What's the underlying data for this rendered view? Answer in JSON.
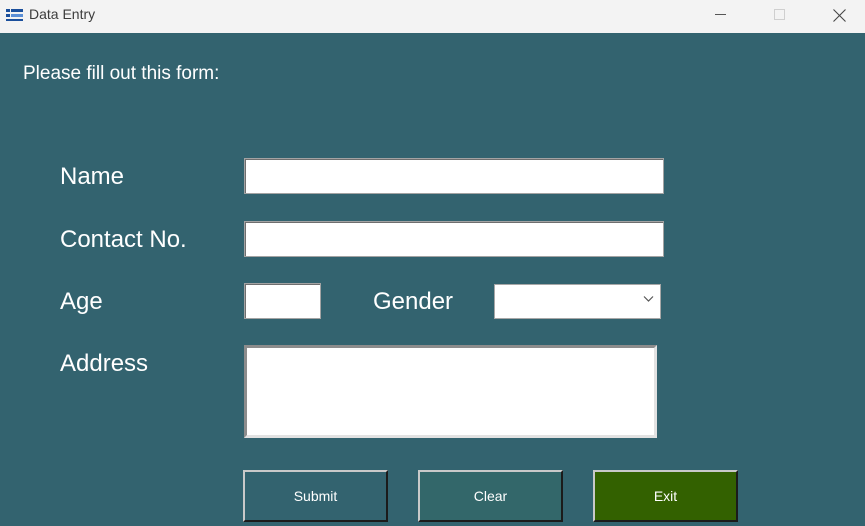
{
  "window": {
    "title": "Data Entry",
    "icon": "window-app-icon",
    "controls": [
      "minimize-icon",
      "maximize-icon",
      "close-icon"
    ]
  },
  "form": {
    "prompt": "Please fill out this form:",
    "name_label": "Name",
    "name_value": "",
    "contact_label": "Contact No.",
    "contact_value": "",
    "age_label": "Age",
    "age_value": "",
    "gender_label": "Gender",
    "gender_selected": "",
    "address_label": "Address",
    "address_value": ""
  },
  "buttons": {
    "submit_label": "Submit",
    "clear_label": "Clear",
    "exit_label": "Exit"
  },
  "colors": {
    "background": "#33636f",
    "submit_button": "#33636f",
    "clear_button": "#33676a",
    "exit_button": "#336100"
  }
}
